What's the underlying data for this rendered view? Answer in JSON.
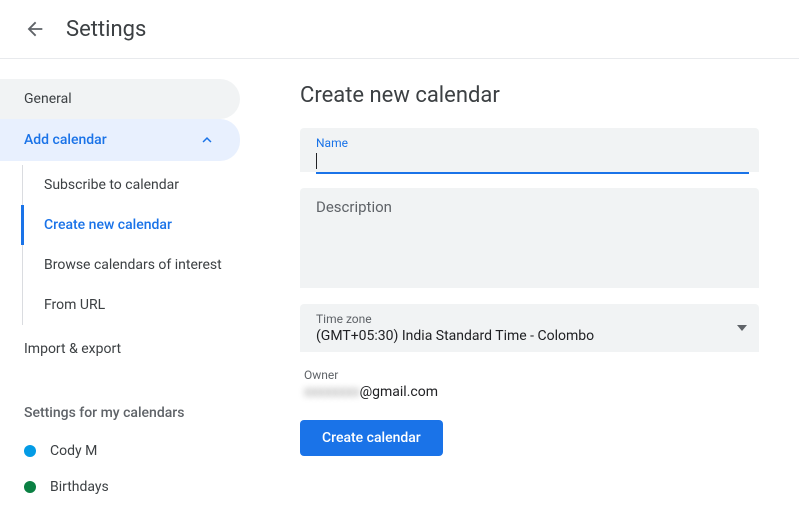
{
  "header": {
    "title": "Settings"
  },
  "sidebar": {
    "general": "General",
    "add_calendar": "Add calendar",
    "subitems": {
      "subscribe": "Subscribe to calendar",
      "create_new": "Create new calendar",
      "browse": "Browse calendars of interest",
      "from_url": "From URL"
    },
    "import_export": "Import & export",
    "settings_heading": "Settings for my calendars",
    "calendars": [
      {
        "label": "Cody M",
        "color": "#039be5"
      },
      {
        "label": "Birthdays",
        "color": "#0b8043"
      }
    ]
  },
  "main": {
    "title": "Create new calendar",
    "name_label": "Name",
    "name_value": "",
    "description_label": "Description",
    "timezone_label": "Time zone",
    "timezone_value": "(GMT+05:30) India Standard Time - Colombo",
    "owner_label": "Owner",
    "owner_masked": "xxxxxxxx",
    "owner_domain": "@gmail.com",
    "create_button": "Create calendar"
  }
}
